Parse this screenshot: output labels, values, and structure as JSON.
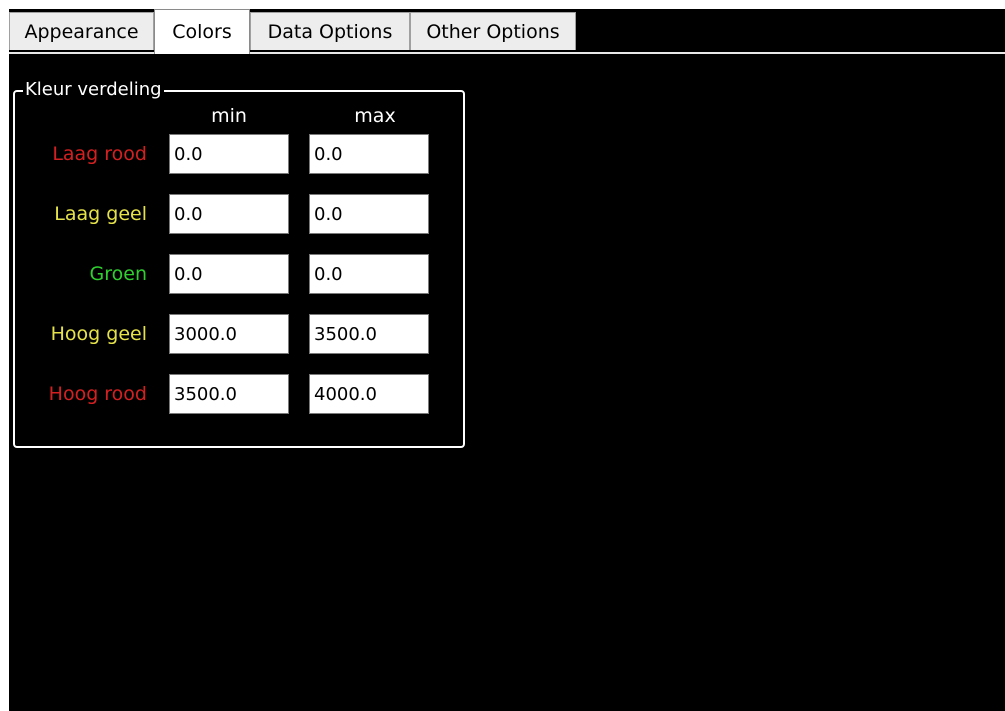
{
  "tabs": [
    {
      "label": "Appearance"
    },
    {
      "label": "Colors"
    },
    {
      "label": "Data Options"
    },
    {
      "label": "Other Options"
    }
  ],
  "active_tab": "Colors",
  "group": {
    "title": "Kleur verdeling",
    "min_label": "min",
    "max_label": "max"
  },
  "rows": [
    {
      "label": "Laag rood",
      "color": "#d42020",
      "min": "0.0",
      "max": "0.0"
    },
    {
      "label": "Laag geel",
      "color": "#e6e34a",
      "min": "0.0",
      "max": "0.0"
    },
    {
      "label": "Groen",
      "color": "#2fcf2f",
      "min": "0.0",
      "max": "0.0"
    },
    {
      "label": "Hoog geel",
      "color": "#e6e34a",
      "min": "3000.0",
      "max": "3500.0"
    },
    {
      "label": "Hoog rood",
      "color": "#d42020",
      "min": "3500.0",
      "max": "4000.0"
    }
  ]
}
